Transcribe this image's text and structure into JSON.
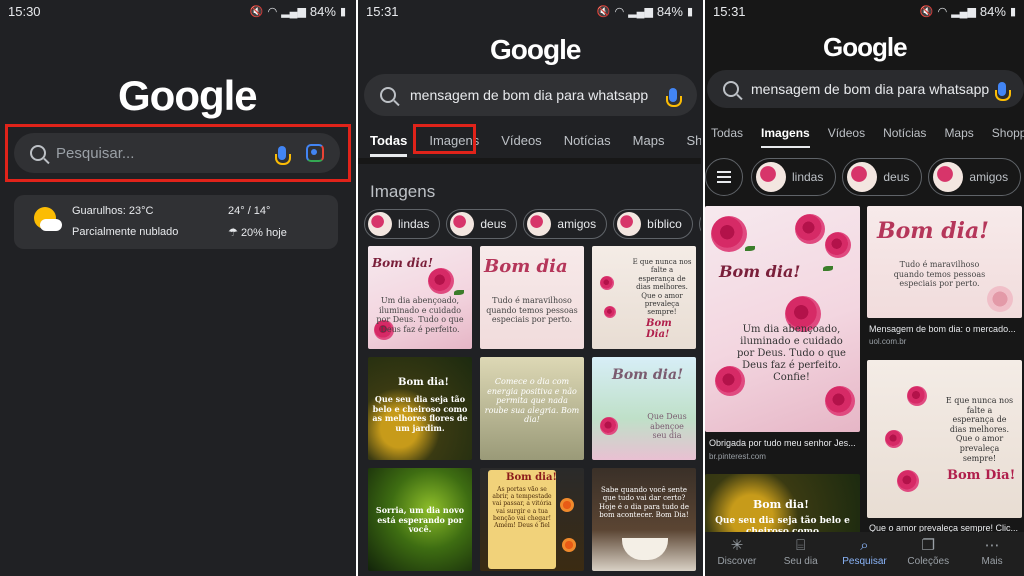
{
  "panel1": {
    "status": {
      "time": "15:30",
      "battery": "84%"
    },
    "logo": "Google",
    "search_placeholder": "Pesquisar...",
    "weather": {
      "location_temp": "Guarulhos: 23°C",
      "condition": "Parcialmente nublado",
      "high_low": "24° / 14°",
      "rain": "20% hoje"
    }
  },
  "panel2": {
    "status": {
      "time": "15:31",
      "battery": "84%"
    },
    "logo": "Google",
    "query": "mensagem de bom dia para whatsapp",
    "tabs": [
      "Todas",
      "Imagens",
      "Vídeos",
      "Notícias",
      "Maps",
      "Shoppin"
    ],
    "section_title": "Imagens",
    "chips": [
      "lindas",
      "deus",
      "amigos",
      "bíblico",
      ""
    ],
    "images": [
      {
        "title": "Bom dia!",
        "caption": "Um dia abençoado, iluminado e cuidado por Deus. Tudo o que Deus faz é perfeito."
      },
      {
        "title": "Bom dia",
        "caption": "Tudo é maravilhoso quando temos pessoas especiais por perto."
      },
      {
        "title": "Bom Dia!",
        "caption": "E que nunca nos falte a esperança de dias melhores. Que o amor prevaleça sempre!"
      },
      {
        "title": "Bom dia!",
        "caption": "Que seu dia seja tão belo e cheiroso como as melhores flores de um jardim."
      },
      {
        "title": "",
        "caption": "Comece o dia com energia positiva e não permita que nada roube sua alegria. Bom dia!"
      },
      {
        "title": "Bom dia!",
        "caption": "Que Deus abençoe seu dia"
      },
      {
        "title": "",
        "caption": "Sorria, um dia novo está esperando por você."
      },
      {
        "title": "Bom dia!",
        "caption": "As portas vão se abrir, a tempestade vai passar, a vitória vai surgir e a tua benção vai chegar! Amém! Deus é fiel"
      },
      {
        "title": "",
        "caption": "Sabe quando você sente que tudo vai dar certo? Hoje é o dia para tudo de bom acontecer. Bom Dia!"
      }
    ]
  },
  "panel3": {
    "status": {
      "time": "15:31",
      "battery": "84%"
    },
    "logo": "Google",
    "query": "mensagem de bom dia para whatsapp",
    "tabs": [
      "Todas",
      "Imagens",
      "Vídeos",
      "Notícias",
      "Maps",
      "Shoppi"
    ],
    "chips": [
      "lindas",
      "deus",
      "amigos"
    ],
    "cards": [
      {
        "title": "Bom dia!",
        "caption": "Um dia abençoado, iluminado e cuidado por Deus. Tudo o que Deus faz é perfeito. Confie!",
        "meta": "Obrigada por tudo meu senhor Jes...",
        "source": "br.pinterest.com"
      },
      {
        "title": "Bom dia!",
        "caption": "Tudo é maravilhoso quando temos pessoas especiais por perto.",
        "meta": "Mensagem de bom dia: o mercado...",
        "source": "uol.com.br"
      },
      {
        "title": "Bom Dia!",
        "caption": "E que nunca nos falte a esperança de dias melhores. Que o amor prevaleça sempre!",
        "meta": "Que o amor prevaleça sempre! Clic...",
        "source": ""
      },
      {
        "title": "Bom dia!",
        "caption": "Que seu dia seja tão belo e cheiroso como",
        "meta": "",
        "source": ""
      }
    ],
    "nav": [
      {
        "label": "Discover",
        "icon": "asterisk-icon"
      },
      {
        "label": "Seu dia",
        "icon": "inbox-icon"
      },
      {
        "label": "Pesquisar",
        "icon": "search-icon"
      },
      {
        "label": "Coleções",
        "icon": "collections-icon"
      },
      {
        "label": "Mais",
        "icon": "more-icon"
      }
    ]
  }
}
